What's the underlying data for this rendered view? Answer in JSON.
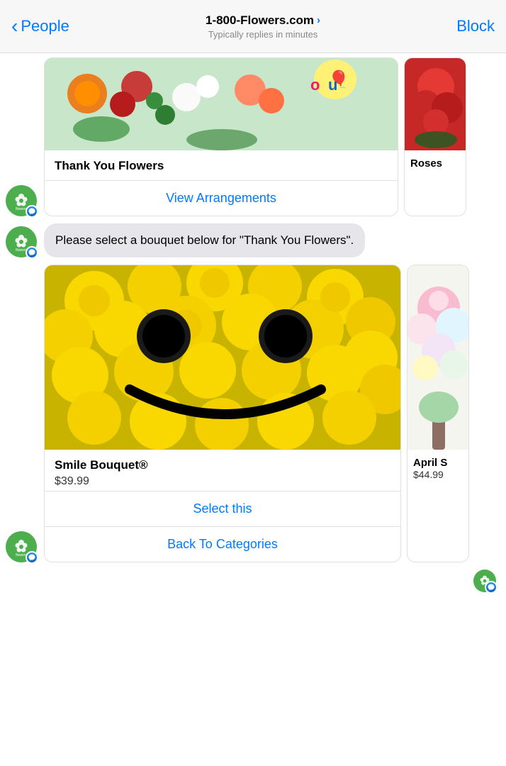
{
  "header": {
    "back_label": "People",
    "title": "1-800-Flowers.com",
    "title_arrow": "›",
    "subtitle": "Typically replies in minutes",
    "block_label": "Block"
  },
  "top_card": {
    "image_alt": "Thank You Flowers arrangement",
    "title": "Thank You Flowers",
    "action_label": "View Arrangements"
  },
  "roses_card": {
    "title": "Roses",
    "image_alt": "Roses arrangement"
  },
  "message_bubble": {
    "text": "Please select a bouquet below for \"Thank You Flowers\"."
  },
  "smile_card": {
    "title": "Smile Bouquet®",
    "price": "$39.99",
    "select_label": "Select this",
    "back_label": "Back To Categories",
    "image_alt": "Smile Bouquet made of yellow chrysanthemums"
  },
  "april_card": {
    "title": "April S",
    "price": "$44.99",
    "image_alt": "April Showers bouquet"
  },
  "colors": {
    "blue": "#007aff",
    "green_avatar": "#4cae4c",
    "bubble_bg": "#e5e5ea",
    "messenger_blue": "#1877f2",
    "yellow_flower": "#d4c800",
    "card_border": "#e0e0e0"
  }
}
